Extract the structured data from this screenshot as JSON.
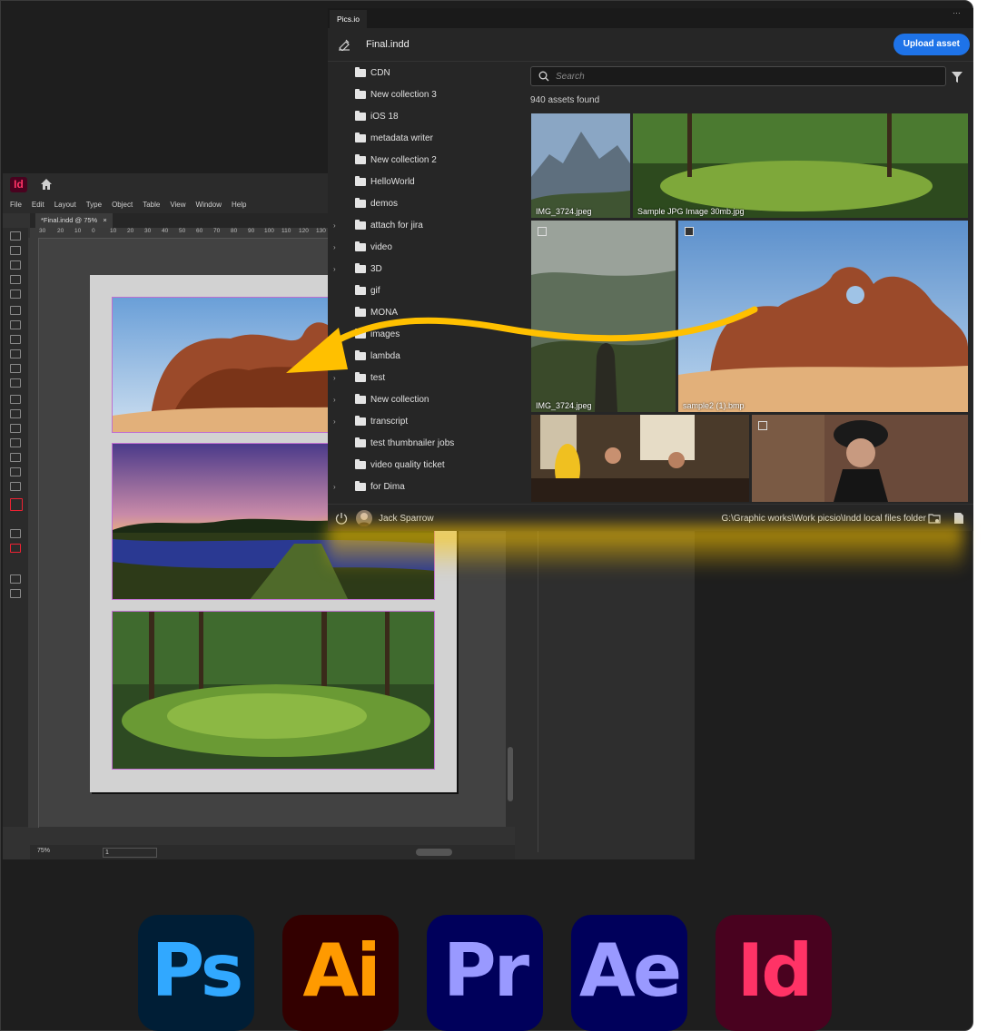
{
  "indesign": {
    "logo": "Id",
    "menu": [
      "File",
      "Edit",
      "Layout",
      "Type",
      "Object",
      "Table",
      "View",
      "Window",
      "Help"
    ],
    "doc_tab": "*Final.indd @ 75%",
    "doc_tab_close": "×",
    "ruler_marks": [
      "30",
      "20",
      "10",
      "0",
      "10",
      "20",
      "30",
      "40",
      "50",
      "60",
      "70",
      "80",
      "90",
      "100",
      "110",
      "120",
      "130"
    ],
    "zoom": "75%",
    "page_number": "1"
  },
  "pics": {
    "tab_label": "Pics.io",
    "file_title": "Final.indd",
    "upload_label": "Upload asset",
    "search_placeholder": "Search",
    "assets_count": "940 assets found",
    "tree": [
      {
        "label": "CDN",
        "expandable": false
      },
      {
        "label": "New collection 3",
        "expandable": false
      },
      {
        "label": "iOS 18",
        "expandable": false
      },
      {
        "label": "metadata writer",
        "expandable": false
      },
      {
        "label": "New collection 2",
        "expandable": false
      },
      {
        "label": "HelloWorld",
        "expandable": false
      },
      {
        "label": "demos",
        "expandable": false
      },
      {
        "label": "attach for jira",
        "expandable": true
      },
      {
        "label": "video",
        "expandable": true
      },
      {
        "label": "3D",
        "expandable": true
      },
      {
        "label": "gif",
        "expandable": false
      },
      {
        "label": "MONA",
        "expandable": false
      },
      {
        "label": "images",
        "expandable": false
      },
      {
        "label": "lambda",
        "expandable": false
      },
      {
        "label": "test",
        "expandable": true
      },
      {
        "label": "New collection",
        "expandable": true
      },
      {
        "label": "transcript",
        "expandable": true
      },
      {
        "label": "test thumbnailer jobs",
        "expandable": false
      },
      {
        "label": "video quality ticket",
        "expandable": false
      },
      {
        "label": "for Dima",
        "expandable": true
      }
    ],
    "assets": [
      {
        "name": "IMG_3724.jpeg"
      },
      {
        "name": "Sample JPG Image 30mb.jpg"
      },
      {
        "name": "IMG_3724.jpeg"
      },
      {
        "name": "sample2 (1).bmp"
      },
      {
        "name": ""
      },
      {
        "name": ""
      }
    ],
    "user_name": "Jack Sparrow",
    "folder_path": "G:\\Graphic works\\Work picsio\\Indd local files folder"
  },
  "apps": [
    {
      "label": "Ps",
      "bg": "#001e36",
      "fg": "#31a8ff"
    },
    {
      "label": "Ai",
      "bg": "#330000",
      "fg": "#ff9a00"
    },
    {
      "label": "Pr",
      "bg": "#00005b",
      "fg": "#9999ff"
    },
    {
      "label": "Ae",
      "bg": "#00005b",
      "fg": "#9999ff"
    },
    {
      "label": "Id",
      "bg": "#49021f",
      "fg": "#ff3366"
    }
  ],
  "colors": {
    "accent": "#1e73e8",
    "arrow": "#ffc000"
  }
}
